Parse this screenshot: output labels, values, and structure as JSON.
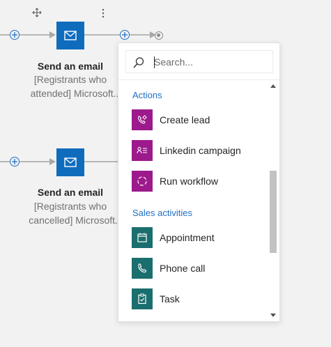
{
  "nodes": [
    {
      "title": "Send an email",
      "subtitle_line1": "[Registrants who",
      "subtitle_line2": "attended] Microsoft...",
      "icon": "mail-icon"
    },
    {
      "title": "Send an email",
      "subtitle_line1": "[Registrants who",
      "subtitle_line2": "cancelled] Microsoft...",
      "icon": "mail-icon"
    }
  ],
  "toolbar": {
    "move_icon": "move-icon",
    "more_icon": "more-options-icon"
  },
  "panel": {
    "search": {
      "placeholder": "Search..."
    },
    "sections": [
      {
        "label": "Actions",
        "items": [
          {
            "label": "Create lead",
            "color": "#9c1a8c",
            "icon": "create-lead-icon"
          },
          {
            "label": "Linkedin campaign",
            "color": "#9c1a8c",
            "icon": "linkedin-campaign-icon"
          },
          {
            "label": "Run workflow",
            "color": "#9c1a8c",
            "icon": "run-workflow-icon"
          }
        ]
      },
      {
        "label": "Sales activities",
        "items": [
          {
            "label": "Appointment",
            "color": "#1b6e6e",
            "icon": "appointment-icon"
          },
          {
            "label": "Phone call",
            "color": "#1b6e6e",
            "icon": "phone-call-icon"
          },
          {
            "label": "Task",
            "color": "#1b6e6e",
            "icon": "task-icon"
          }
        ]
      }
    ]
  },
  "colors": {
    "accent": "#0f6cbd",
    "section_label": "#1f6fc5",
    "canvas_bg": "#f2f2f2"
  }
}
